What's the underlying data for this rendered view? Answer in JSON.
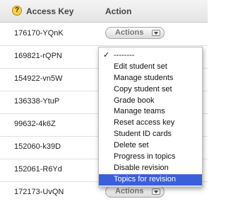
{
  "header": {
    "help_icon": "?",
    "access_key_label": "Access Key",
    "action_label": "Action"
  },
  "rows": [
    {
      "key": "176170-YQnK",
      "button": "Actions"
    },
    {
      "key": "169821-rQPN",
      "button": ""
    },
    {
      "key": "154922-vn5W",
      "button": ""
    },
    {
      "key": "136338-YtuP",
      "button": ""
    },
    {
      "key": "99632-4k6Z",
      "button": ""
    },
    {
      "key": "152060-k39D",
      "button": ""
    },
    {
      "key": "152061-R6Yd",
      "button": ""
    },
    {
      "key": "172173-UvQN",
      "button": "Actions"
    }
  ],
  "menu": {
    "check_mark": "✓",
    "items": [
      "--------",
      "Edit student set",
      "Manage students",
      "Copy student set",
      "Grade book",
      "Manage teams",
      "Reset access key",
      "Student ID cards",
      "Delete set",
      "Progress in topics",
      "Disable revision",
      "Topics for revision"
    ],
    "checked_item": "--------",
    "selected_item": "Topics for revision"
  },
  "colors": {
    "selection": "#3a5fd9",
    "help_icon": "#f6cf4f"
  }
}
